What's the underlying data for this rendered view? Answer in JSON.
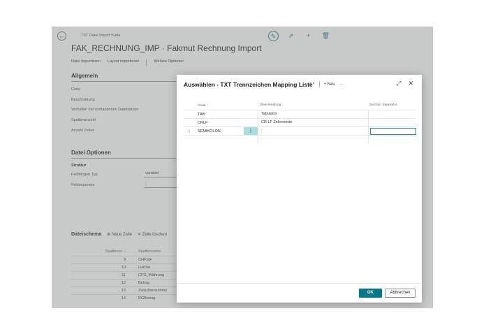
{
  "background": {
    "breadcrumb": "TXT Datei Import Karte",
    "title": "FAK_RECHNUNG_IMP · Fakmut Rechnung Import",
    "actions": [
      "Datei importieren",
      "Layout importieren",
      "Weitere Optionen"
    ],
    "sections": {
      "general": {
        "title": "Allgemein",
        "fields": [
          "Code",
          "Beschreibung",
          "Verhalten bei vorhandenen Dateisätzen",
          "Spaltenanzahl",
          "Anzahl Zeilen"
        ]
      },
      "file_options": {
        "title": "Datei Optionen",
        "group": "Struktur",
        "fields": [
          {
            "label": "Feldlängen Typ",
            "value": "variabel"
          },
          {
            "label": "Feldseperator",
            "value": ";"
          }
        ]
      }
    },
    "schema": {
      "title": "Dateischema",
      "new_row": "Neue Zeile",
      "delete_row": "Zeile löschen",
      "headers": [
        "Spaltennr. ↑",
        "Spaltenname"
      ],
      "rows": [
        {
          "num": "9",
          "name": "CHFStk"
        },
        {
          "num": "10",
          "name": "ListDat"
        },
        {
          "num": "11",
          "name": "CFG_Währung"
        },
        {
          "num": "12",
          "name": "Betrag"
        },
        {
          "num": "13",
          "name": "Zwischensumme"
        },
        {
          "num": "14",
          "name": "RGBetrag"
        }
      ]
    }
  },
  "dialog": {
    "title": "Auswählen - TXT Trennzeichen Mapping Liste",
    "search_icon": "search-icon",
    "new_label": "Neu",
    "more_label": "···",
    "columns": [
      "Code ↑",
      "Beschreibung",
      "Zeichen Seperator"
    ],
    "rows": [
      {
        "code": "TAB",
        "desc": "Tabulator",
        "sep": ""
      },
      {
        "code": "CRLF",
        "desc": "CR LF Zeilenende",
        "sep": ""
      },
      {
        "code": "SEMIKOLON",
        "desc": ";",
        "sep": "",
        "selected": true
      }
    ],
    "ok_label": "OK",
    "cancel_label": "Abbrechen",
    "accent_color": "#00798a"
  }
}
